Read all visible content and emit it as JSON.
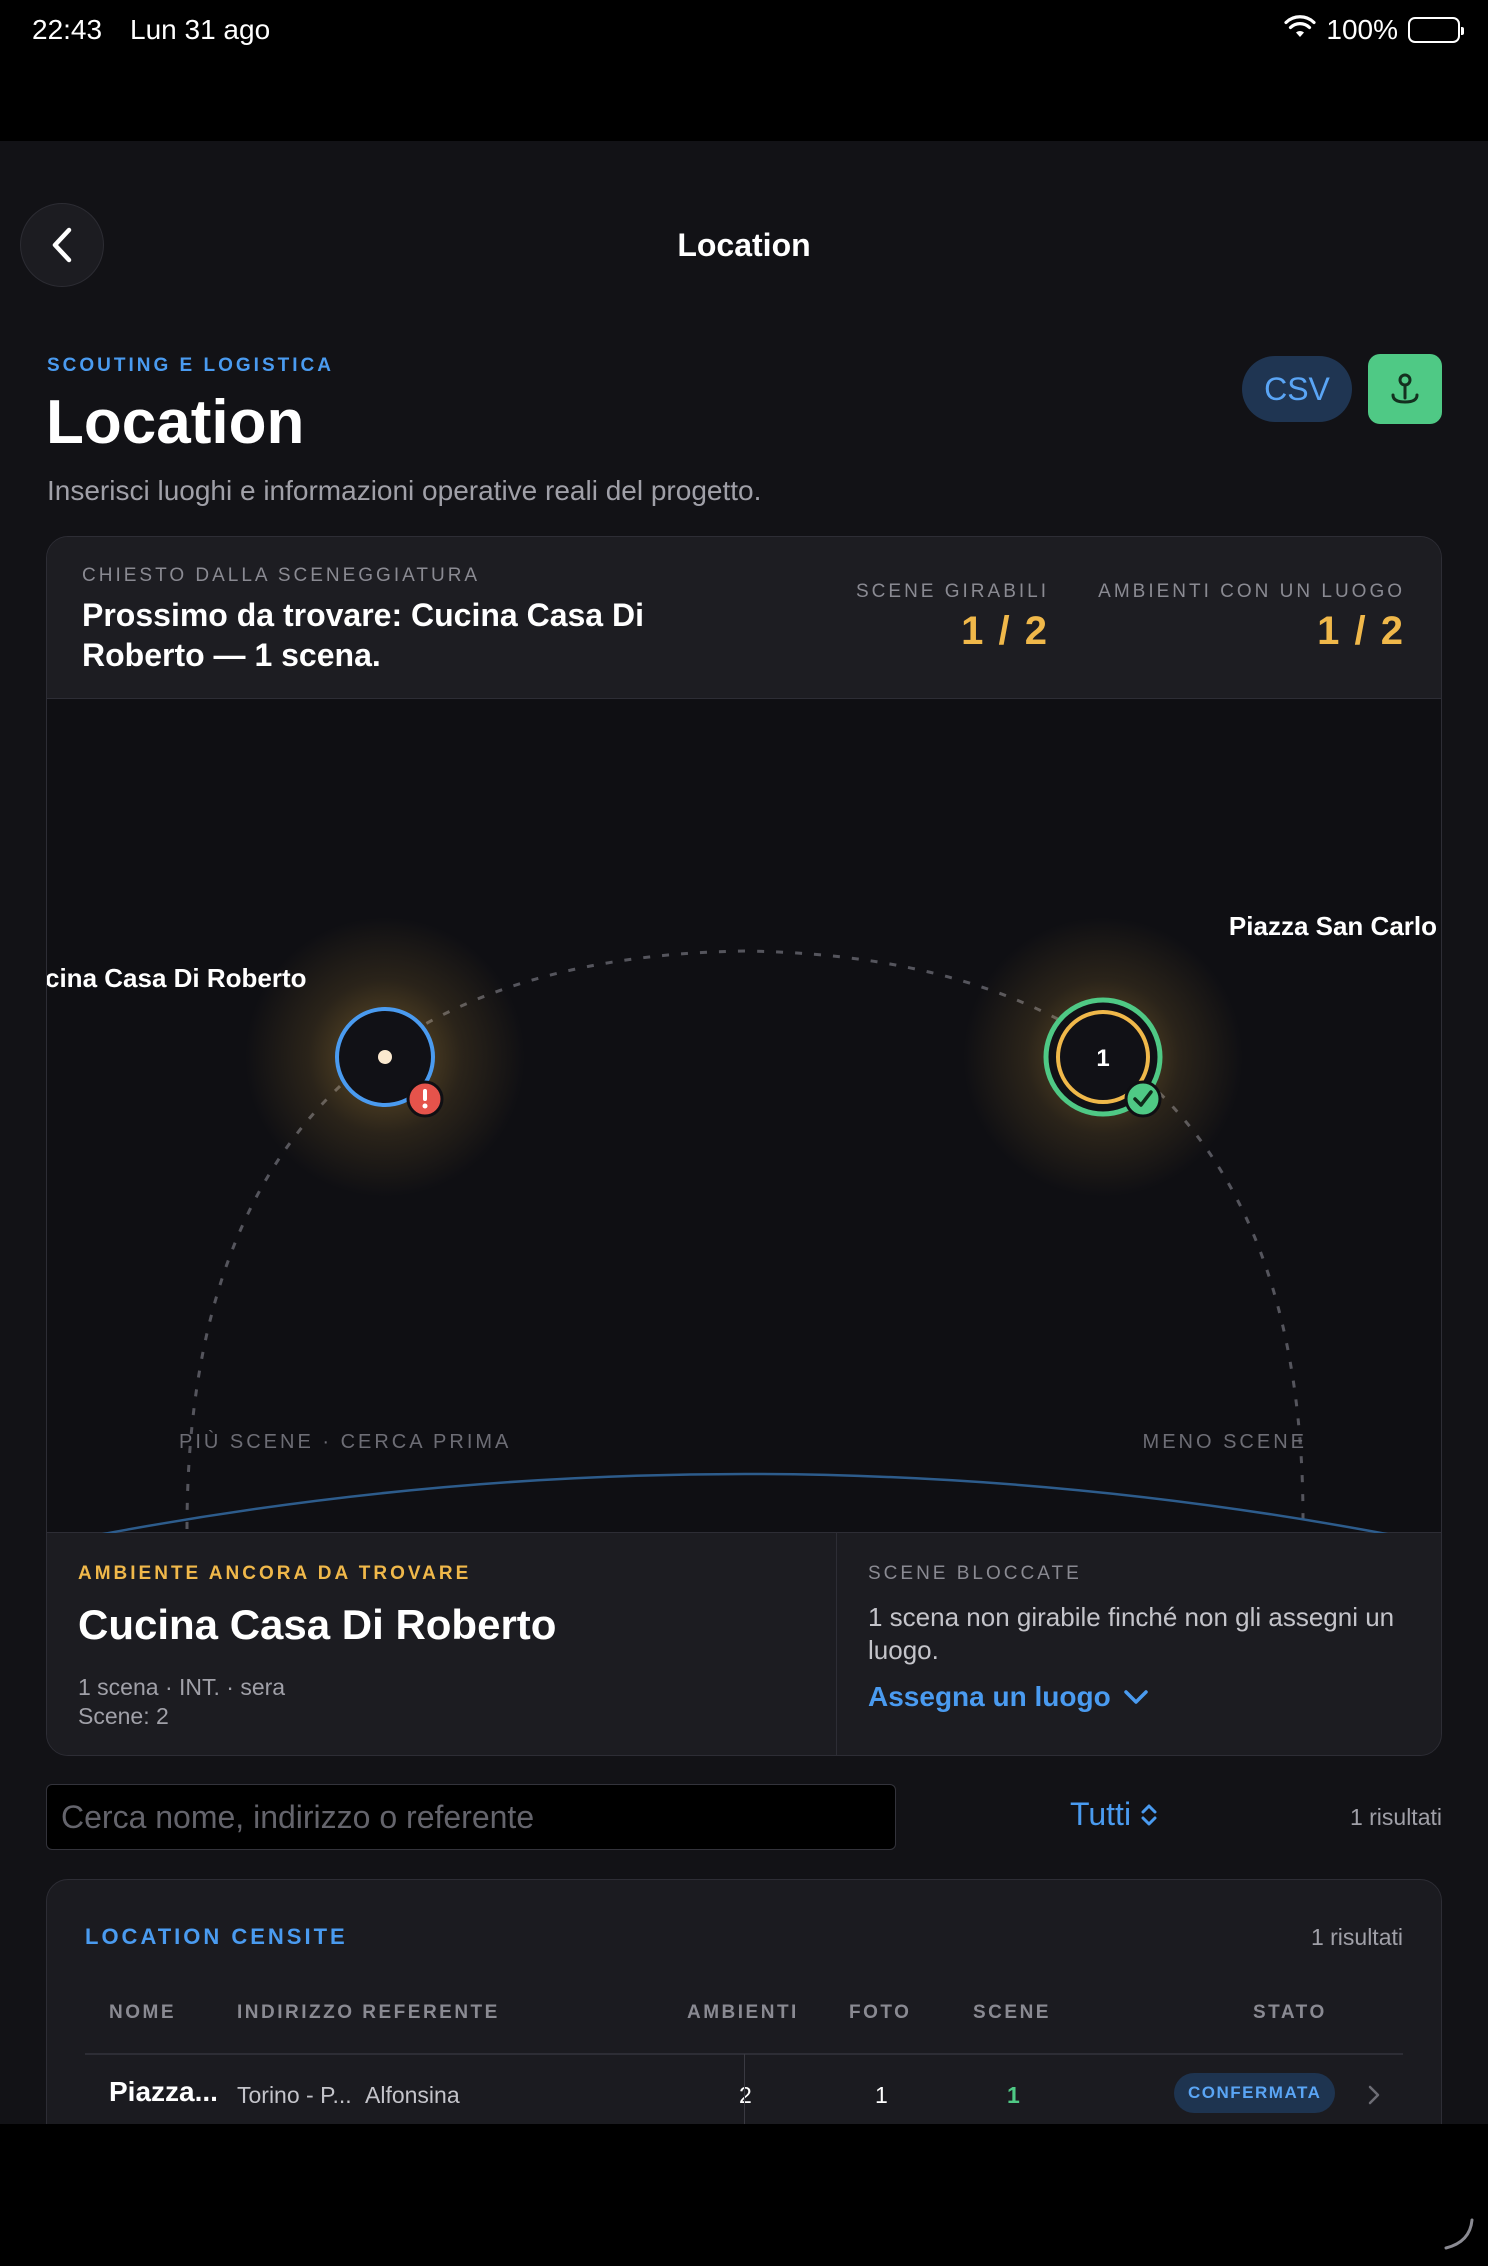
{
  "status_bar": {
    "time": "22:43",
    "date": "Lun 31 ago",
    "battery": "100%"
  },
  "nav": {
    "title": "Location"
  },
  "header": {
    "eyebrow": "SCOUTING E LOGISTICA",
    "title": "Location",
    "subtitle": "Inserisci luoghi e informazioni operative reali del progetto.",
    "csv_label": "CSV",
    "map_icon": "map-pin-icon"
  },
  "summary": {
    "eyebrow": "CHIESTO DALLA SCENEGGIATURA",
    "text": "Prossimo da trovare: Cucina Casa Di Roberto — 1 scena.",
    "stats": [
      {
        "label": "SCENE GIRABILI",
        "value": "1 / 2"
      },
      {
        "label": "AMBIENTI CON UN LUOGO",
        "value": "1 / 2"
      }
    ]
  },
  "map": {
    "pins": [
      {
        "label": "cina Casa Di Roberto",
        "status": "missing",
        "inner": ""
      },
      {
        "label": "Piazza San Carlo",
        "status": "confirmed",
        "inner": "1"
      }
    ],
    "axis_left": "PIÙ SCENE · CERCA PRIMA",
    "axis_right": "MENO SCENE",
    "colors": {
      "warning": "#e5534b",
      "confirmed": "#4fc985",
      "accent": "#4a9bf0",
      "glow": "#f0b84a"
    }
  },
  "detail": {
    "eyebrow": "AMBIENTE ANCORA DA TROVARE",
    "title": "Cucina Casa Di Roberto",
    "meta_line1": "1 scena · INT. · sera",
    "meta_line2": "Scene: 2",
    "blocked_eyebrow": "SCENE BLOCCATE",
    "blocked_text": "1 scena non girabile finché non gli assegni un luogo.",
    "assign_label": "Assegna un luogo"
  },
  "search": {
    "placeholder": "Cerca nome, indirizzo o referente",
    "filter_value": "Tutti",
    "results": "1 risultati"
  },
  "table": {
    "title": "LOCATION CENSITE",
    "count": "1 risultati",
    "columns": [
      "NOME",
      "INDIRIZZO REFERENTE",
      "AMBIENTI",
      "FOTO",
      "SCENE",
      "STATO"
    ],
    "rows": [
      {
        "nome": "Piazza...",
        "indirizzo": "Torino - P...",
        "referente": "Alfonsina",
        "ambienti": "2",
        "foto": "1",
        "scene": "1",
        "stato": "CONFERMATA"
      }
    ]
  }
}
